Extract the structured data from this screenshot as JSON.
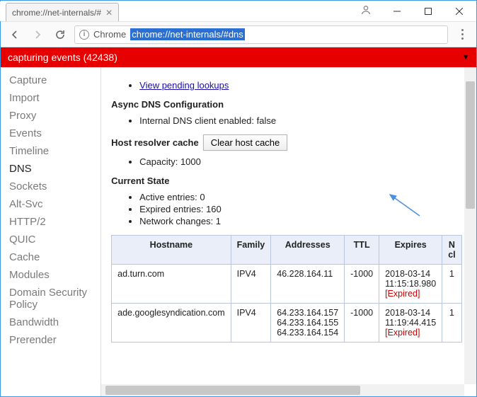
{
  "window": {
    "tab_title": "chrome://net-internals/#"
  },
  "toolbar": {
    "scheme_label": "Chrome",
    "url": "chrome://net-internals/#dns"
  },
  "red_bar": {
    "text": "capturing events (42438)"
  },
  "sidebar": {
    "items": [
      {
        "label": "Capture"
      },
      {
        "label": "Import"
      },
      {
        "label": "Proxy"
      },
      {
        "label": "Events"
      },
      {
        "label": "Timeline"
      },
      {
        "label": "DNS",
        "active": true
      },
      {
        "label": "Sockets"
      },
      {
        "label": "Alt-Svc"
      },
      {
        "label": "HTTP/2"
      },
      {
        "label": "QUIC"
      },
      {
        "label": "Cache"
      },
      {
        "label": "Modules"
      },
      {
        "label": "Domain Security Policy"
      },
      {
        "label": "Bandwidth"
      },
      {
        "label": "Prerender"
      }
    ]
  },
  "main": {
    "pending_link": "View pending lookups",
    "async_heading": "Async DNS Configuration",
    "async_item": "Internal DNS client enabled: false",
    "cache_label": "Host resolver cache",
    "clear_button": "Clear host cache",
    "capacity_item": "Capacity: 1000",
    "state_heading": "Current State",
    "state_items": [
      "Active entries: 0",
      "Expired entries: 160",
      "Network changes: 1"
    ],
    "table": {
      "headers": [
        "Hostname",
        "Family",
        "Addresses",
        "TTL",
        "Expires",
        "N cl"
      ],
      "rows": [
        {
          "hostname": "ad.turn.com",
          "family": "IPV4",
          "addresses": [
            "46.228.164.11"
          ],
          "ttl": "-1000",
          "expires": "2018-03-14 11:15:18.980",
          "expired": "[Expired]",
          "n": "1"
        },
        {
          "hostname": "ade.googlesyndication.com",
          "family": "IPV4",
          "addresses": [
            "64.233.164.157",
            "64.233.164.155",
            "64.233.164.154"
          ],
          "ttl": "-1000",
          "expires": "2018-03-14 11:19:44.415",
          "expired": "[Expired]",
          "n": "1"
        }
      ]
    }
  }
}
